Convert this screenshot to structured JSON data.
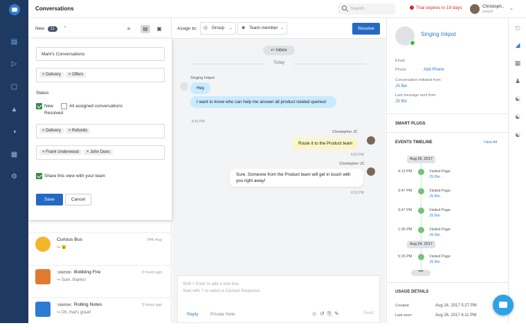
{
  "app": {
    "title": "Conversations"
  },
  "header": {
    "search_placeholder": "Search",
    "trial_text": "Trial expires in 19 days",
    "user_name": "Christoph..",
    "user_role": "penpal"
  },
  "list_header": {
    "label": "New",
    "count": "11"
  },
  "filter": {
    "view_name": "Mark's Conversations",
    "labels": [
      "Delivery",
      "Offers"
    ],
    "status_title": "Status",
    "status_new": "New",
    "status_all": "All assigned conversations",
    "status_resolved": "Resolved",
    "groups": [
      "Delivery",
      "Refunds"
    ],
    "agents": [
      "Frank Underwood",
      "John Does"
    ],
    "share_label": "Share this view with your team",
    "save": "Save",
    "cancel": "Cancel"
  },
  "conversations": [
    {
      "name": "Curious Bus",
      "time": "24th Aug",
      "snippet": "😮"
    },
    {
      "name": "Bobbing Fire",
      "badge": "VISITOR",
      "time": "3 hours ago",
      "snippet": "Sure, thanks!"
    },
    {
      "name": "Rolling Notes",
      "badge": "VISITOR",
      "time": "3 hours ago",
      "snippet": "Oh, that's great!"
    }
  ],
  "chat_toolbar": {
    "assign_to": "Assign to:",
    "group": "Group",
    "team_member": "Team member",
    "resolve": "Resolve"
  },
  "messages": {
    "inbox": "Inbox",
    "today": "Today",
    "visitor_name": "Singing Inkpot",
    "m1": "Hey",
    "m2": "I want to know who can help me answer all product related queries!",
    "m2_time": "6:41 PM",
    "agent_name": "Christopher JC",
    "m3": "Route it to the Product team",
    "m3_time": "6:52 PM",
    "m4": "Sure. Someone from the Product team will get in touch with you right away!",
    "m4_time": "6:52 PM"
  },
  "compose": {
    "placeholder_1": "Shift + Enter to add a new line,",
    "placeholder_2": "Start with '/' to select a Canned Response.",
    "reply_tab": "Reply",
    "private_tab": "Private Note",
    "send": "Send"
  },
  "profile": {
    "name": "Singing Inkpot",
    "email_label": "Email",
    "phone_label": "Phone",
    "add_phone": "Add Phone",
    "initiated_label": "Conversation Initiated from",
    "initiated_value": "JS Bin",
    "last_sent_label": "Last message sent from",
    "last_sent_value": "JS Bin",
    "smart_plugs": "SMART PLUGS",
    "events_timeline": "EVENTS TIMELINE",
    "view_all": "View All",
    "timeline_date1": "Aug 26, 2017",
    "timeline_date2": "Aug 24, 2017",
    "events": [
      {
        "time": "4:13 PM",
        "action": "Visited Page",
        "source": "JS Bin"
      },
      {
        "time": "3:47 PM",
        "action": "Visited Page",
        "source": "JS Bin"
      },
      {
        "time": "3:47 PM",
        "action": "Visited Page",
        "source": "JS Bin"
      },
      {
        "time": "1:36 PM",
        "action": "Visited Page",
        "source": "JS Bin"
      },
      {
        "time": "5:26 PM",
        "action": "Visited Page",
        "source": "JS Bin"
      }
    ],
    "more": "•••",
    "usage_details": "USAGE DETAILS",
    "created_label": "Created",
    "created_value": "Aug 24, 2017 5:27 PM",
    "last_seen_label": "Last seen",
    "last_seen_value": "Aug 26, 2017 6:11 PM"
  },
  "icons": {
    "nav": [
      "inbox-icon",
      "megaphone-icon",
      "document-icon",
      "bank-icon",
      "people-icon",
      "apps-icon",
      "settings-icon"
    ],
    "colors": {
      "nav_bg": "#1f3a60",
      "primary": "#2469c4",
      "link": "#2e7bd4",
      "visitor_bubble": "#c9ebff",
      "note_bubble": "#fbf6c8",
      "trial": "#dd2233"
    }
  }
}
